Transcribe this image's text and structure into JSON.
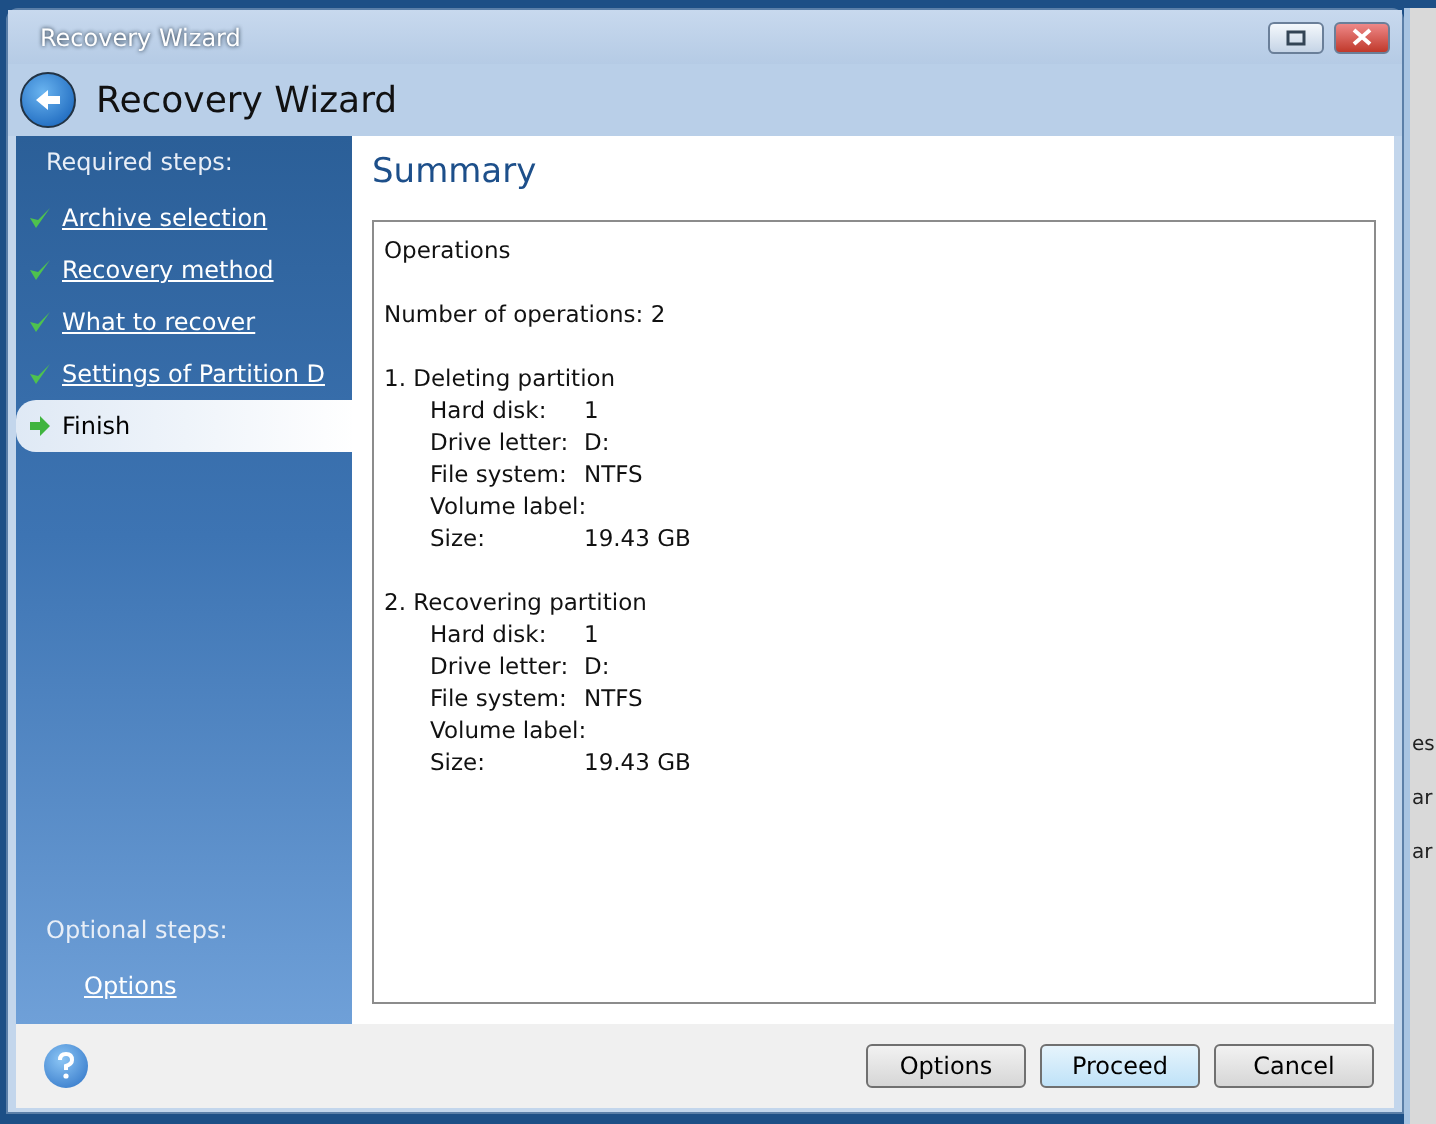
{
  "window": {
    "title": "Recovery Wizard",
    "heading": "Recovery Wizard"
  },
  "sidebar": {
    "required_title": "Required steps:",
    "steps": [
      {
        "label": "Archive selection",
        "done": true,
        "selected": false
      },
      {
        "label": "Recovery method",
        "done": true,
        "selected": false
      },
      {
        "label": "What to recover",
        "done": true,
        "selected": false
      },
      {
        "label": "Settings of Partition D",
        "done": true,
        "selected": false
      },
      {
        "label": "Finish",
        "done": false,
        "selected": true
      }
    ],
    "optional_title": "Optional steps:",
    "optional_steps": [
      {
        "label": "Options"
      }
    ]
  },
  "content": {
    "title": "Summary",
    "summary": {
      "heading": "Operations",
      "count": "Number of operations: 2",
      "operations": [
        {
          "title": "1. Deleting partition",
          "fields": [
            {
              "label": "Hard disk:",
              "value": "1"
            },
            {
              "label": "Drive letter:",
              "value": "D:"
            },
            {
              "label": "File system:",
              "value": "NTFS"
            },
            {
              "label": "Volume label:"
            },
            {
              "label": "Size:",
              "value": "19.43 GB"
            }
          ]
        },
        {
          "title": "2. Recovering partition",
          "fields": [
            {
              "label": "Hard disk:",
              "value": "1"
            },
            {
              "label": "Drive letter:",
              "value": "D:"
            },
            {
              "label": "File system:",
              "value": "NTFS"
            },
            {
              "label": "Volume label:"
            },
            {
              "label": "Size:",
              "value": "19.43 GB"
            }
          ]
        }
      ]
    }
  },
  "buttons": [
    {
      "label": "Options",
      "focused": false
    },
    {
      "label": "Proceed",
      "focused": true
    },
    {
      "label": "Cancel",
      "focused": false
    }
  ],
  "background_window": {
    "fragments": [
      "es",
      "ar",
      "ar"
    ]
  }
}
